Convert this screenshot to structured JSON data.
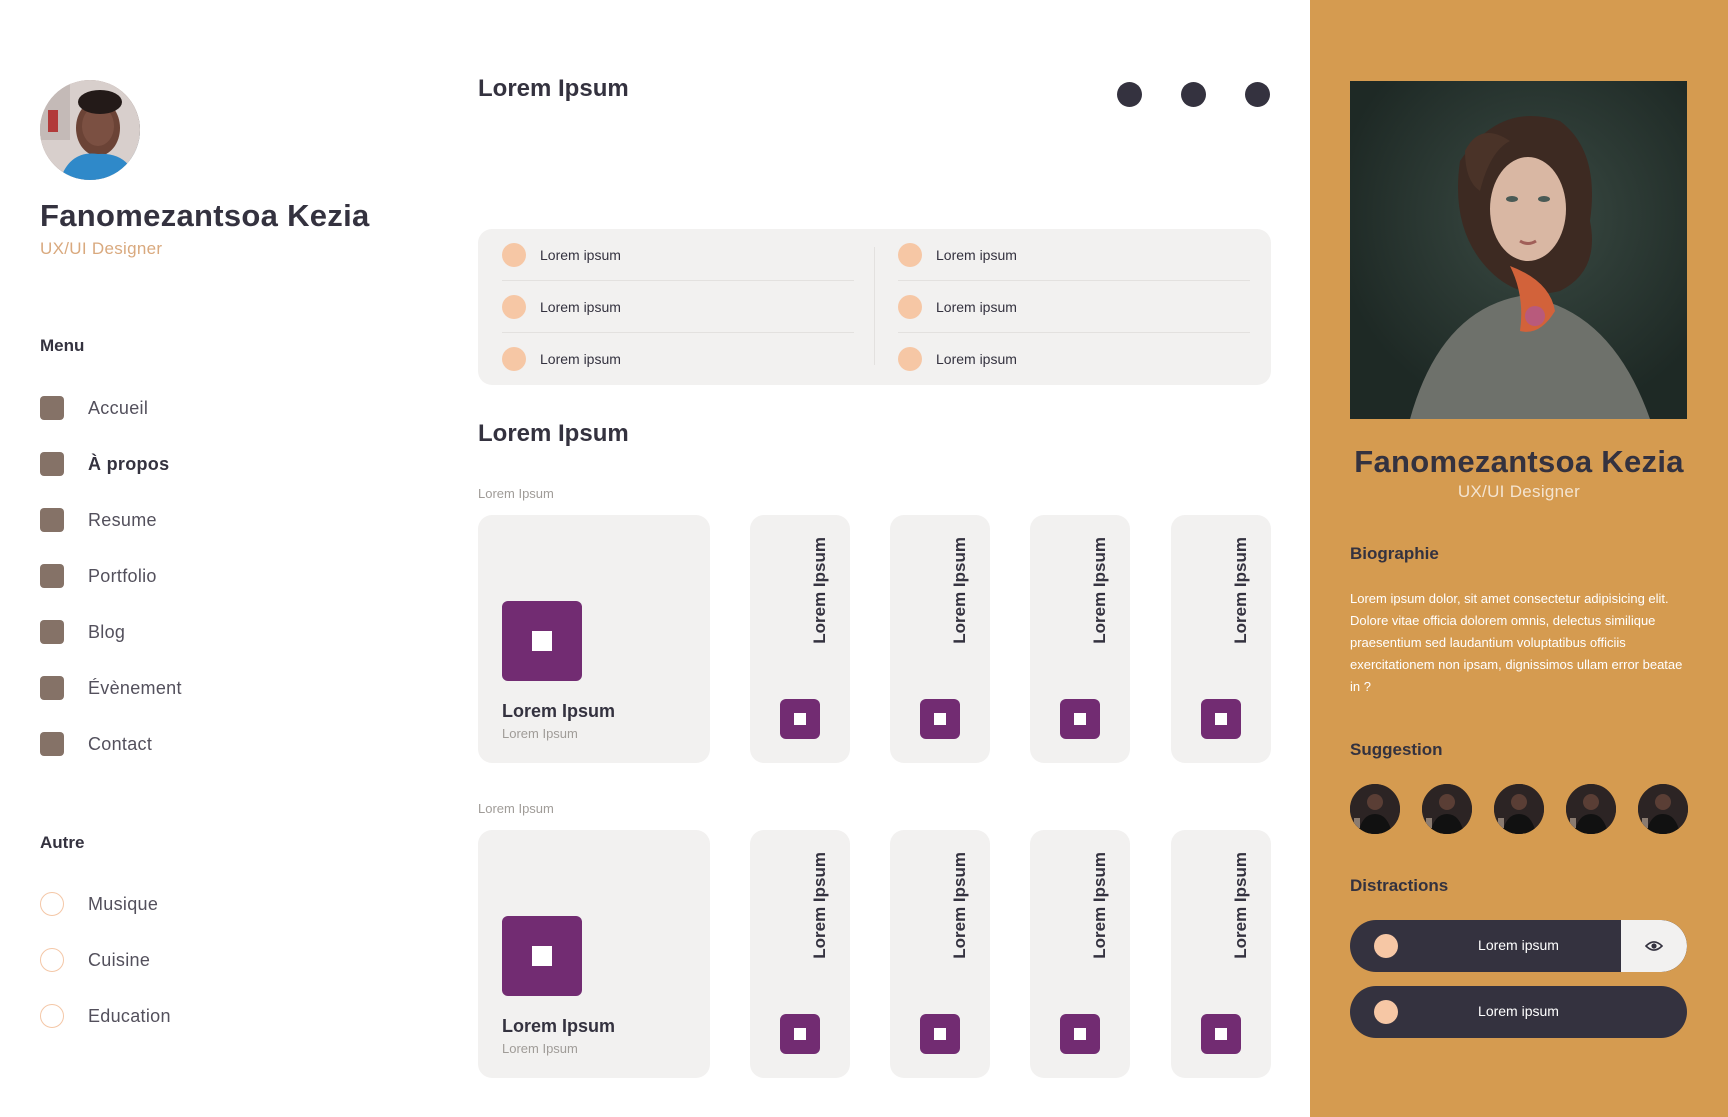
{
  "profile": {
    "name": "Fanomezantsoa Kezia",
    "role": "UX/UI Designer"
  },
  "menu": {
    "title": "Menu",
    "items": [
      {
        "label": "Accueil",
        "active": false
      },
      {
        "label": "À propos",
        "active": true
      },
      {
        "label": "Resume",
        "active": false
      },
      {
        "label": "Portfolio",
        "active": false
      },
      {
        "label": "Blog",
        "active": false
      },
      {
        "label": "Évènement",
        "active": false
      },
      {
        "label": "Contact",
        "active": false
      }
    ]
  },
  "other": {
    "title": "Autre",
    "items": [
      {
        "label": "Musique"
      },
      {
        "label": "Cuisine"
      },
      {
        "label": "Education"
      }
    ]
  },
  "main": {
    "title1": "Lorem Ipsum",
    "list": {
      "col1": [
        "Lorem ipsum",
        "Lorem ipsum",
        "Lorem ipsum"
      ],
      "col2": [
        "Lorem ipsum",
        "Lorem ipsum",
        "Lorem ipsum"
      ]
    },
    "title2": "Lorem Ipsum",
    "sections": [
      {
        "label": "Lorem Ipsum",
        "big_card": {
          "title": "Lorem Ipsum",
          "subtitle": "Lorem Ipsum"
        },
        "tall_cards": [
          "Lorem Ipsum",
          "Lorem Ipsum",
          "Lorem Ipsum",
          "Lorem Ipsum"
        ]
      },
      {
        "label": "Lorem Ipsum",
        "big_card": {
          "title": "Lorem Ipsum",
          "subtitle": "Lorem Ipsum"
        },
        "tall_cards": [
          "Lorem Ipsum",
          "Lorem Ipsum",
          "Lorem Ipsum",
          "Lorem Ipsum"
        ]
      }
    ]
  },
  "right": {
    "name": "Fanomezantsoa Kezia",
    "role": "UX/UI Designer",
    "bio_title": "Biographie",
    "bio": "Lorem ipsum dolor, sit amet consectetur adipisicing elit. Dolore vitae officia dolorem omnis, delectus similique praesentium sed laudantium voluptatibus officiis exercitationem non ipsam, dignissimos ullam error beatae in ?",
    "suggestion_title": "Suggestion",
    "distractions_title": "Distractions",
    "distractions": [
      "Lorem ipsum",
      "Lorem ipsum"
    ]
  },
  "icons": {
    "nav_dots": [
      "dot-icon",
      "dot-icon",
      "dot-icon"
    ],
    "eye": "eye-icon",
    "card_icon": "square-icon"
  },
  "colors": {
    "dark": "#34323f",
    "accent_orange": "#d59b50",
    "peach": "#f6c7a5",
    "purple": "#722c72",
    "menu_square": "#857267",
    "card_bg": "#f2f1f0"
  }
}
